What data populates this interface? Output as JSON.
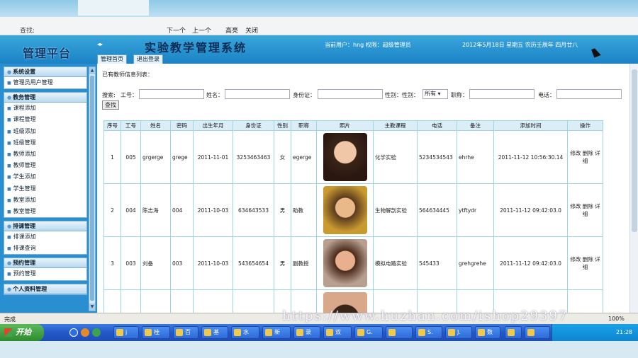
{
  "find_bar": {
    "label": "查找:",
    "next": "下一个",
    "prev": "上一个",
    "highlight": "高亮",
    "close": "关闭"
  },
  "header": {
    "logo": "管理平台",
    "system_title": "实验教学管理系统",
    "user_info": "当前用户：hng 权限：超级管理员",
    "date": "2012年5月18日 星期五 农历壬辰年 四月廿八",
    "tabs": [
      "管理首页",
      "退出登录"
    ]
  },
  "sidebar": [
    {
      "title": "系统设置",
      "items": [
        "管理员用户管理"
      ]
    },
    {
      "title": "教务管理",
      "items": [
        "课程添加",
        "课程管理",
        "班级添加",
        "班级管理",
        "教师添加",
        "教师管理",
        "学生添加",
        "学生管理",
        "教室添加",
        "教室管理"
      ]
    },
    {
      "title": "排课管理",
      "items": [
        "排课添加",
        "排课查询"
      ]
    },
    {
      "title": "预约管理",
      "items": [
        "预约管理"
      ]
    },
    {
      "title": "个人资料管理",
      "items": []
    }
  ],
  "page": {
    "title": "已有教师信息列表：",
    "search": {
      "lead": "搜索:",
      "gonghao": "工号：",
      "name": "姓名：",
      "idcard": "身份证：",
      "gender": "性别：性别：",
      "gender_value": "所有",
      "title": "职称：",
      "phone": "电话：",
      "button": "查找"
    }
  },
  "table": {
    "headers": [
      "序号",
      "工号",
      "姓名",
      "密码",
      "出生年月",
      "身份证",
      "性别",
      "职称",
      "照片",
      "主教课程",
      "电话",
      "备注",
      "添加时间",
      "操作"
    ],
    "rows": [
      {
        "no": "1",
        "id": "005",
        "name": "grgerge",
        "pwd": "grege",
        "birth": "2011-11-01",
        "idcard": "3253463463",
        "sex": "女",
        "title": "egerge",
        "course": "化学实验",
        "phone": "5234534543",
        "note": "ehrhe",
        "time": "2011-11-12 10:56:30.14",
        "ops": "修改 删除 详细"
      },
      {
        "no": "2",
        "id": "004",
        "name": "陈志海",
        "pwd": "004",
        "birth": "2011-10-03",
        "idcard": "634643533",
        "sex": "男",
        "title": "助教",
        "course": "生物解剖实验",
        "phone": "564634445",
        "note": "ytftydr",
        "time": "2011-11-12 09:42:03.0",
        "ops": "修改 删除 详细"
      },
      {
        "no": "3",
        "id": "003",
        "name": "刘备",
        "pwd": "003",
        "birth": "2011-10-03",
        "idcard": "543654654",
        "sex": "男",
        "title": "副教授",
        "course": "模拟电路实验",
        "phone": "545433",
        "note": "grehgrehe",
        "time": "2011-11-12 09:42:03.0",
        "ops": "修改 删除 详细"
      }
    ]
  },
  "status": {
    "left": "完成",
    "zoom": "100%"
  },
  "taskbar": {
    "start": "开始",
    "buttons": [
      "j",
      "桂",
      "百",
      "基",
      "水",
      "新",
      "录",
      "双",
      "G.",
      "",
      "S.",
      "J.",
      "数",
      "",
      ""
    ],
    "clock": "21:28"
  },
  "watermark": "https://www.huzhan.com/ishop29397"
}
